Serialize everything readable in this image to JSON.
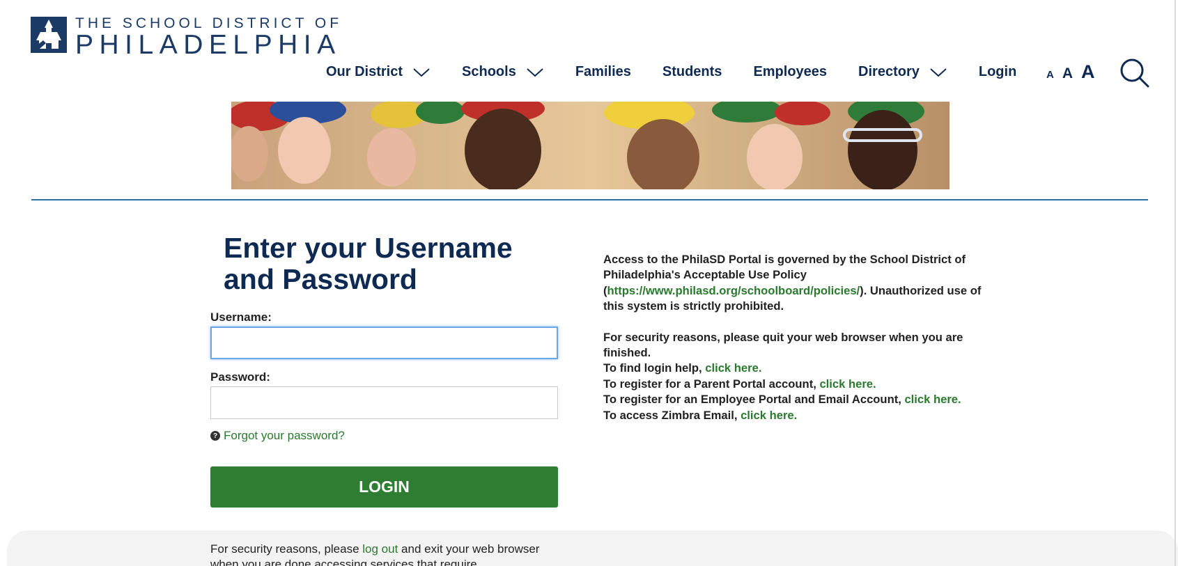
{
  "header": {
    "logo_line1": "THE SCHOOL DISTRICT OF",
    "logo_line2": "PHILADELPHIA",
    "nav": [
      {
        "label": "Our District",
        "dropdown": true
      },
      {
        "label": "Schools",
        "dropdown": true
      },
      {
        "label": "Families",
        "dropdown": false
      },
      {
        "label": "Students",
        "dropdown": false
      },
      {
        "label": "Employees",
        "dropdown": false
      },
      {
        "label": "Directory",
        "dropdown": true
      },
      {
        "label": "Login",
        "dropdown": false
      }
    ],
    "font_size_small": "A",
    "font_size_medium": "A",
    "font_size_large": "A",
    "search_icon": "search-icon"
  },
  "banner": {
    "subject": "Children in graduation caps"
  },
  "form": {
    "heading_line1": "Enter your Username",
    "heading_line2": "and Password",
    "username_label": "Username:",
    "username_value": "",
    "password_label": "Password:",
    "password_value": "",
    "forgot_label": "Forgot your password?",
    "login_label": "LOGIN"
  },
  "footer_note": {
    "text1": "For security reasons, please ",
    "link": "log out",
    "text2": " and exit your web browser when you are done accessing services that require"
  },
  "info": {
    "policy_text1": "Access to the PhilaSD Portal is governed by the School District of Philadelphia's Acceptable Use Policy (",
    "policy_link": "https://www.philasd.org/schoolboard/policies/",
    "policy_text2": "). Unauthorized use of this system is strictly prohibited.",
    "security_text": "For security reasons, please quit your web browser when you are finished.",
    "login_help_text": "To find login help, ",
    "parent_portal_text": "To register for a Parent Portal account, ",
    "employee_portal_text": "To register for an Employee Portal and Email Account, ",
    "zimbra_text": "To access Zimbra Email, ",
    "click_here": "click here."
  },
  "colors": {
    "navy": "#0e2a52",
    "green": "#2e7d32",
    "link_green": "#2a7a2e",
    "divider_blue": "#2d6fa6"
  }
}
